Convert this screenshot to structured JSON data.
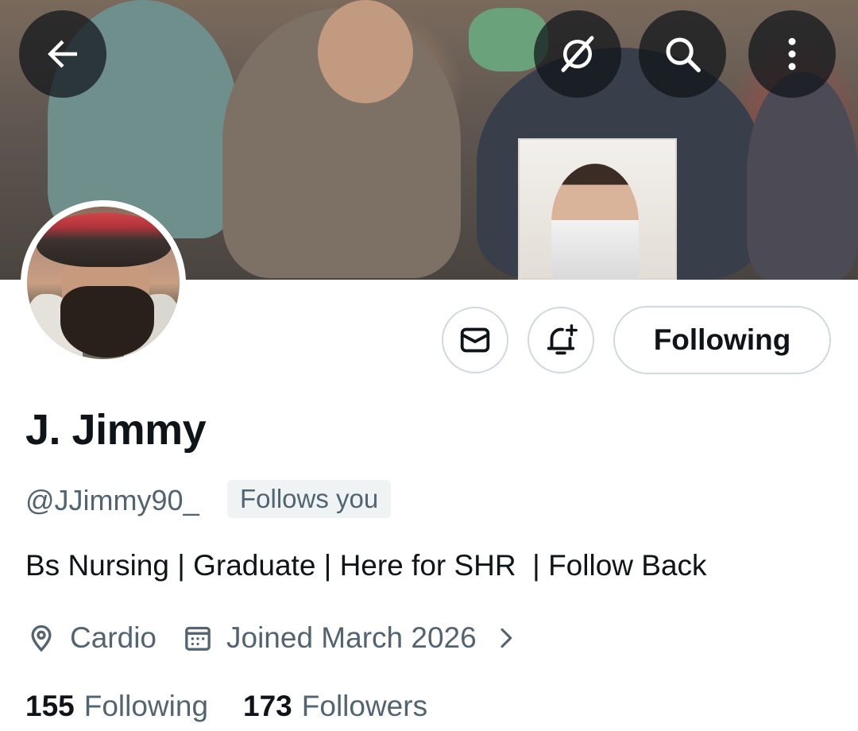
{
  "profile": {
    "display_name": "J. Jimmy",
    "handle": "@JJimmy90_",
    "follows_you_label": "Follows you",
    "bio": "Bs Nursing | Graduate | Here for SHR  | Follow Back",
    "location": "Cardio",
    "joined": "Joined March 2026",
    "following_count": "155",
    "following_label": "Following",
    "followers_count": "173",
    "followers_label": "Followers"
  },
  "actions": {
    "follow_state_label": "Following"
  },
  "icons": {
    "back": "back-arrow-icon",
    "grok": "grok-icon",
    "search": "search-icon",
    "more": "more-options-icon",
    "message": "envelope-icon",
    "notify": "bell-plus-icon",
    "location": "location-pin-icon",
    "calendar": "calendar-icon",
    "chevron": "chevron-right-icon"
  },
  "colors": {
    "text_primary": "#0f1419",
    "text_secondary": "#536471",
    "border": "#cfd9de",
    "badge_bg": "#eff3f4",
    "overlay_button": "#0f1419"
  }
}
